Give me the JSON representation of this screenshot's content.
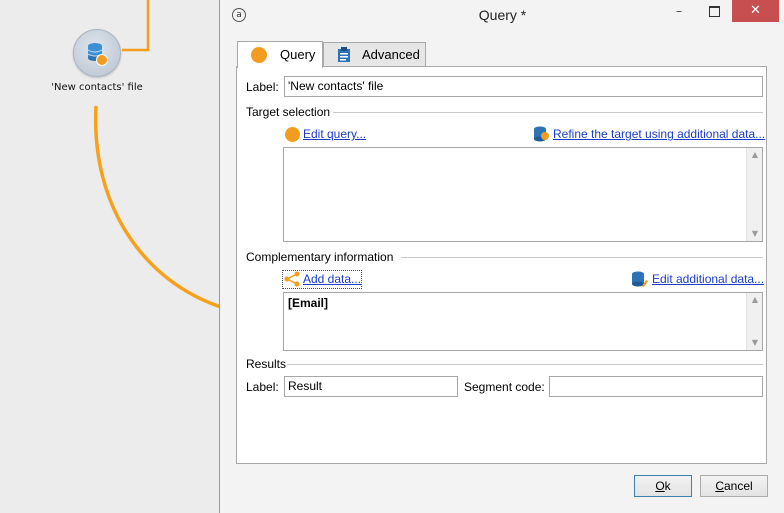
{
  "workflow": {
    "node_label": "'New contacts' file"
  },
  "dialog": {
    "title": "Query *",
    "window_controls": {
      "minimize": "–",
      "close": "✕"
    },
    "tabs": [
      {
        "label": "Query",
        "active": true
      },
      {
        "label": "Advanced",
        "active": false
      }
    ],
    "label_caption": "Label:",
    "label_value": "'New contacts' file",
    "target_selection": {
      "heading": "Target selection",
      "edit_query_link": "Edit query...",
      "refine_link": "Refine the target using additional data..."
    },
    "complementary": {
      "heading": "Complementary information",
      "add_data_link": "Add data...",
      "edit_additional_link": "Edit additional data...",
      "content": "[Email]"
    },
    "results": {
      "heading": "Results",
      "label_caption": "Label:",
      "label_value": "Result",
      "segment_caption": "Segment code:",
      "segment_value": ""
    },
    "buttons": {
      "ok_first": "O",
      "ok_rest": "k",
      "cancel_first": "C",
      "cancel_rest": "ancel"
    }
  },
  "colors": {
    "accent_orange": "#f39c1f",
    "link_blue": "#1a3cc8",
    "close_red": "#c74f4f"
  }
}
